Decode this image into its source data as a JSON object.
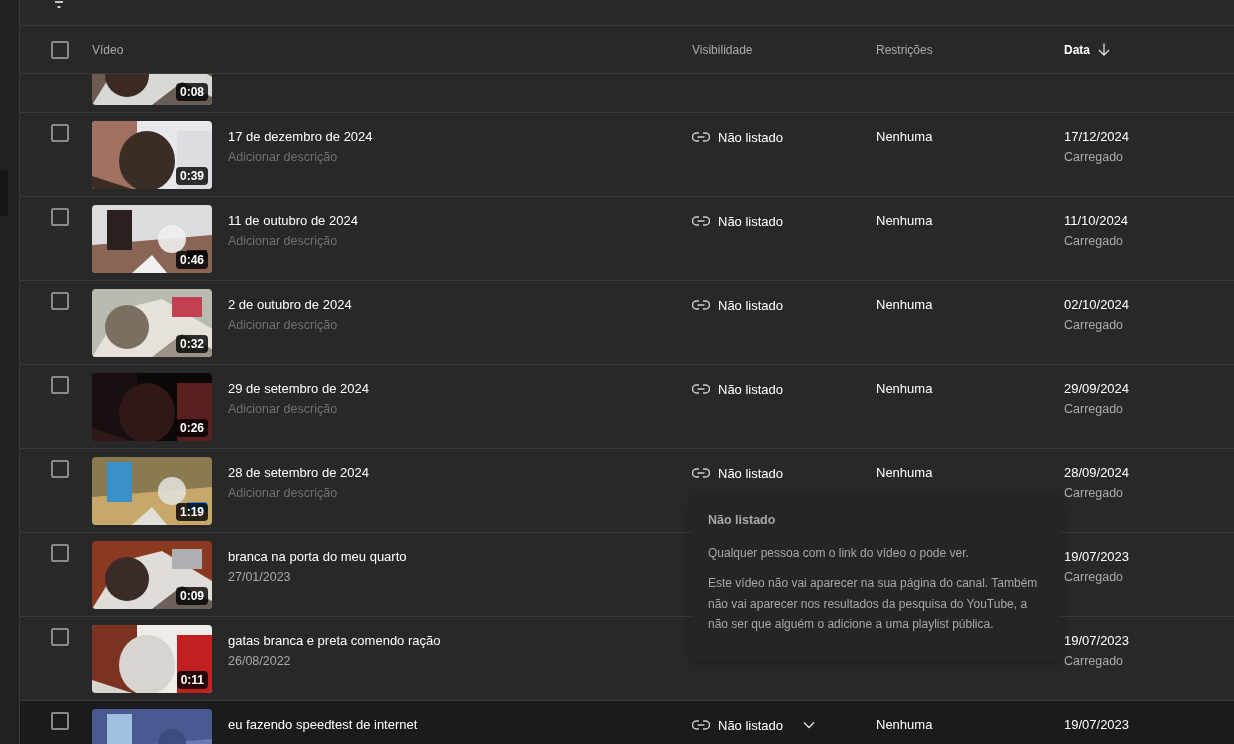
{
  "select_all": {
    "checked": false
  },
  "columns": [
    {
      "label": "Vídeo",
      "sorted": false
    },
    {
      "label": "Visibilidade",
      "sorted": false
    },
    {
      "label": "Restrições",
      "sorted": false
    },
    {
      "label": "Data",
      "sorted": true
    }
  ],
  "rows": [
    {
      "duration": "0:08"
    },
    {
      "title": "17 de dezembro de 2024",
      "description_placeholder": "Adicionar descrição",
      "duration": "0:39",
      "visibility": "Não listado",
      "restrictions": "Nenhuma",
      "date": "17/12/2024",
      "date_status": "Carregado",
      "checked": false,
      "hovered": false
    },
    {
      "title": "11 de outubro de 2024",
      "description_placeholder": "Adicionar descrição",
      "duration": "0:46",
      "visibility": "Não listado",
      "restrictions": "Nenhuma",
      "date": "11/10/2024",
      "date_status": "Carregado",
      "checked": false,
      "hovered": false
    },
    {
      "title": "2 de outubro de 2024",
      "description_placeholder": "Adicionar descrição",
      "duration": "0:32",
      "visibility": "Não listado",
      "restrictions": "Nenhuma",
      "date": "02/10/2024",
      "date_status": "Carregado",
      "checked": false,
      "hovered": false
    },
    {
      "title": "29 de setembro de 2024",
      "description_placeholder": "Adicionar descrição",
      "duration": "0:26",
      "visibility": "Não listado",
      "restrictions": "Nenhuma",
      "date": "29/09/2024",
      "date_status": "Carregado",
      "checked": false,
      "hovered": false
    },
    {
      "title": "28 de setembro de 2024",
      "description_placeholder": "Adicionar descrição",
      "duration": "1:19",
      "visibility": "Não listado",
      "restrictions": "Nenhuma",
      "date": "28/09/2024",
      "date_status": "Carregado",
      "checked": false,
      "hovered": false
    },
    {
      "title": "branca na porta do meu quarto",
      "description": "27/01/2023",
      "duration": "0:09",
      "date": "19/07/2023",
      "date_status": "Carregado",
      "checked": false
    },
    {
      "title": "gatas branca e preta comendo ração",
      "description": "26/08/2022",
      "duration": "0:11",
      "date": "19/07/2023",
      "date_status": "Carregado",
      "checked": false
    },
    {
      "title": "eu fazendo speedtest de internet",
      "visibility": "Não listado",
      "restrictions": "Nenhuma",
      "date": "19/07/2023",
      "checked": false,
      "hovered": true
    }
  ],
  "tooltip": {
    "title": "Não listado",
    "paragraphs": [
      "Qualquer pessoa com o link do vídeo o pode ver.",
      "Este vídeo não vai aparecer na sua página do canal. Também não vai aparecer nos resultados da pesquisa do YouTube, a não ser que alguém o adicione a uma playlist pública."
    ]
  }
}
